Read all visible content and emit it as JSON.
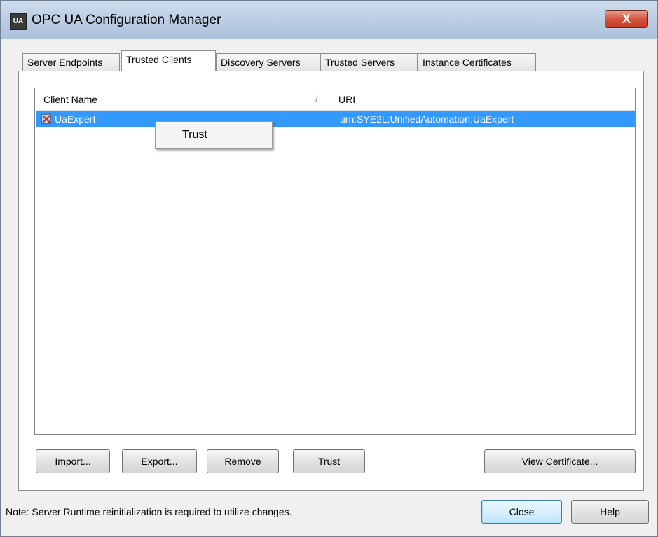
{
  "window": {
    "title": "OPC UA Configuration Manager",
    "app_icon_text": "UA",
    "close_glyph": "X"
  },
  "tabs": [
    {
      "label": "Server Endpoints",
      "active": false
    },
    {
      "label": "Trusted Clients",
      "active": true
    },
    {
      "label": "Discovery Servers",
      "active": false
    },
    {
      "label": "Trusted Servers",
      "active": false
    },
    {
      "label": "Instance Certificates",
      "active": false
    }
  ],
  "list": {
    "columns": [
      "Client Name",
      "URI"
    ],
    "sort_indicator": "/",
    "rows": [
      {
        "client_name": "UaExpert",
        "uri": "urn:SYE2L:UnifiedAutomation:UaExpert",
        "selected": true,
        "icon": "untrusted-certificate-icon"
      }
    ]
  },
  "context_menu": {
    "items": [
      "Trust"
    ]
  },
  "buttons": {
    "import": "Import...",
    "export": "Export...",
    "remove": "Remove",
    "trust": "Trust",
    "view_certificate": "View Certificate...",
    "close": "Close",
    "help": "Help"
  },
  "footer": {
    "note": "Note:  Server Runtime reinitialization is required to utilize changes."
  },
  "colors": {
    "selection": "#3399ff",
    "titlebar": "#b9cbe2",
    "close_button": "#c33b24"
  }
}
